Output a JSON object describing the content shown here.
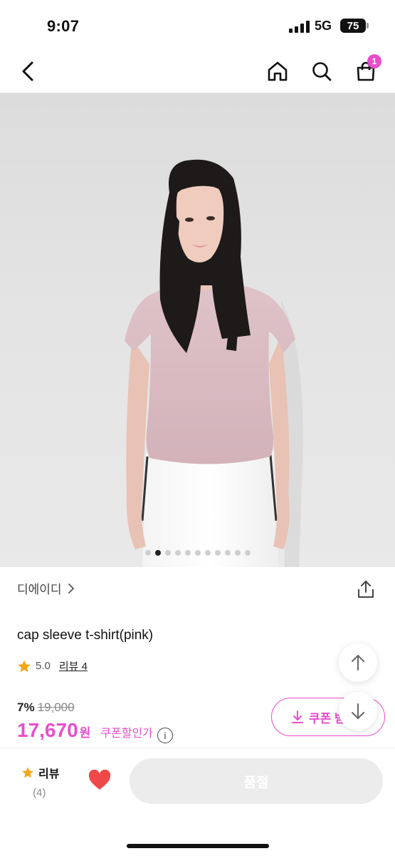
{
  "status_bar": {
    "time": "9:07",
    "network": "5G",
    "battery": "75"
  },
  "nav": {
    "cart_count": "1",
    "icons": [
      "back-icon",
      "home-icon",
      "search-icon",
      "cart-icon"
    ]
  },
  "gallery": {
    "image_count": 11,
    "active_index": 1
  },
  "product": {
    "brand": "디에이디",
    "title": "cap sleeve t-shirt(pink)",
    "rating": "5.0",
    "review_link": "리뷰 4"
  },
  "price": {
    "discount_pct": "7%",
    "original_price": "19,000",
    "final_price": "17,670",
    "unit": "원",
    "coupon_label": "쿠폰할인가"
  },
  "coupon_button": {
    "label": "쿠폰 받"
  },
  "bottom_bar": {
    "review_label": "리뷰",
    "review_count": "(4)",
    "soldout_label": "품절"
  },
  "colors": {
    "accent": "#e84ecb",
    "star": "#f0a81c",
    "heart": "#f04848",
    "disabled": "#ececec"
  }
}
